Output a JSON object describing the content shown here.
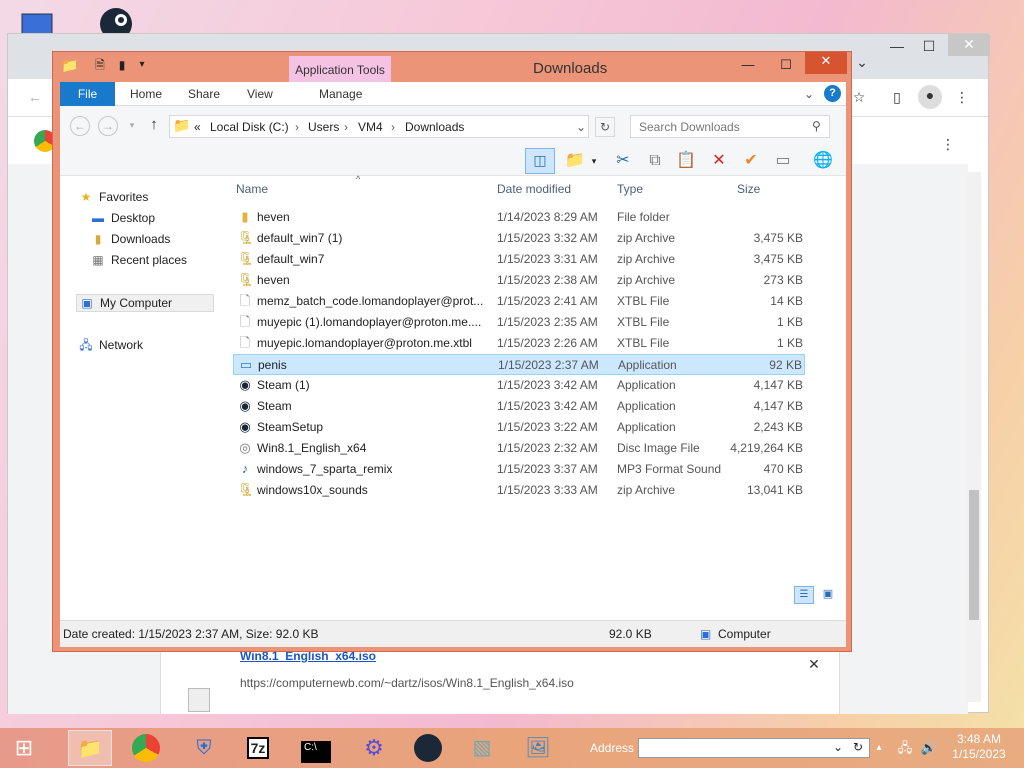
{
  "desktop": {
    "icons": [
      "computer-icon",
      "steam-desktop-icon"
    ]
  },
  "chrome": {
    "download": {
      "filename": "Win8.1_English_x64.iso",
      "url": "https://computernewb.com/~dartz/isos/Win8.1_English_x64.iso"
    }
  },
  "explorer": {
    "title": "Downloads",
    "application_tools": "Application Tools",
    "ribbon_tabs": [
      "File",
      "Home",
      "Share",
      "View",
      "Manage"
    ],
    "breadcrumb": [
      "«",
      "Local Disk (C:)",
      "Users",
      "VM4",
      "Downloads"
    ],
    "search_placeholder": "Search Downloads",
    "nav": {
      "favorites": "Favorites",
      "desktop": "Desktop",
      "downloads": "Downloads",
      "recent": "Recent places",
      "computer": "My Computer",
      "network": "Network"
    },
    "columns": {
      "name": "Name",
      "date": "Date modified",
      "type": "Type",
      "size": "Size"
    },
    "files": [
      {
        "name": "heven",
        "date": "1/14/2023 8:29 AM",
        "type": "File folder",
        "size": "",
        "icon": "folder-icon"
      },
      {
        "name": "default_win7 (1)",
        "date": "1/15/2023 3:32 AM",
        "type": "zip Archive",
        "size": "3,475 KB",
        "icon": "zip-icon"
      },
      {
        "name": "default_win7",
        "date": "1/15/2023 3:31 AM",
        "type": "zip Archive",
        "size": "3,475 KB",
        "icon": "zip-icon"
      },
      {
        "name": "heven",
        "date": "1/15/2023 2:38 AM",
        "type": "zip Archive",
        "size": "273 KB",
        "icon": "zip-icon"
      },
      {
        "name": "memz_batch_code.lomandoplayer@prot...",
        "date": "1/15/2023 2:41 AM",
        "type": "XTBL File",
        "size": "14 KB",
        "icon": "file-icon"
      },
      {
        "name": "muyepic (1).lomandoplayer@proton.me....",
        "date": "1/15/2023 2:35 AM",
        "type": "XTBL File",
        "size": "1 KB",
        "icon": "file-icon"
      },
      {
        "name": "muyepic.lomandoplayer@proton.me.xtbl",
        "date": "1/15/2023 2:26 AM",
        "type": "XTBL File",
        "size": "1 KB",
        "icon": "file-icon"
      },
      {
        "name": "penis",
        "date": "1/15/2023 2:37 AM",
        "type": "Application",
        "size": "92 KB",
        "icon": "application-icon",
        "selected": true
      },
      {
        "name": "Steam (1)",
        "date": "1/15/2023 3:42 AM",
        "type": "Application",
        "size": "4,147 KB",
        "icon": "steam-icon"
      },
      {
        "name": "Steam",
        "date": "1/15/2023 3:42 AM",
        "type": "Application",
        "size": "4,147 KB",
        "icon": "steam-icon"
      },
      {
        "name": "SteamSetup",
        "date": "1/15/2023 3:22 AM",
        "type": "Application",
        "size": "2,243 KB",
        "icon": "steam-icon"
      },
      {
        "name": "Win8.1_English_x64",
        "date": "1/15/2023 2:32 AM",
        "type": "Disc Image File",
        "size": "4,219,264 KB",
        "icon": "disc-image-icon"
      },
      {
        "name": "windows_7_sparta_remix",
        "date": "1/15/2023 3:37 AM",
        "type": "MP3 Format Sound",
        "size": "470 KB",
        "icon": "audio-icon"
      },
      {
        "name": "windows10x_sounds",
        "date": "1/15/2023 3:33 AM",
        "type": "zip Archive",
        "size": "13,041 KB",
        "icon": "zip-icon"
      }
    ],
    "status": {
      "details": "Date created: 1/15/2023 2:37 AM, Size: 92.0 KB",
      "size": "92.0 KB",
      "location": "Computer"
    }
  },
  "taskbar": {
    "address_label": "Address",
    "time": "3:48 AM",
    "date": "1/15/2023"
  }
}
